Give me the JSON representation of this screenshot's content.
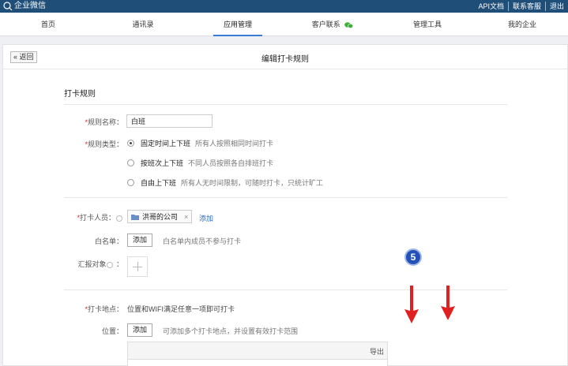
{
  "topbar": {
    "app_name": "企业微信",
    "links": [
      "API文档",
      "联系客服",
      "退出"
    ]
  },
  "nav": {
    "items": [
      {
        "label": "首页"
      },
      {
        "label": "通讯录"
      },
      {
        "label": "应用管理",
        "active": true
      },
      {
        "label": "客户联系",
        "has_wechat_icon": true
      },
      {
        "label": "管理工具"
      },
      {
        "label": "我的企业"
      }
    ]
  },
  "panel": {
    "back_label": "« 返回",
    "title": "编辑打卡规则"
  },
  "form": {
    "section_title": "打卡规则",
    "rule_name": {
      "label": "规则名称：",
      "value": "白班"
    },
    "rule_type": {
      "label": "规则类型：",
      "options": [
        {
          "title": "固定时间上下班",
          "desc": "所有人按照相同时间打卡",
          "checked": true
        },
        {
          "title": "按班次上下班",
          "desc": "不同人员按照各自排班打卡",
          "checked": false
        },
        {
          "title": "自由上下班",
          "desc": "所有人无时间限制，可随时打卡，只统计旷工",
          "checked": false
        }
      ]
    },
    "checkin_people": {
      "label": "打卡人员：",
      "tag": "洪哥的公司",
      "tag_close": "×",
      "add_label": "添加"
    },
    "whitelist": {
      "label": "白名单：",
      "button": "添加",
      "hint": "白名单内成员不参与打卡"
    },
    "report_target": {
      "label": "汇报对象"
    },
    "checkin_location": {
      "label": "打卡地点：",
      "desc": "位置和WIFI满足任意一项即可打卡"
    },
    "location": {
      "label": "位置：",
      "button": "添加",
      "hint": "可添加多个打卡地点，并设置有效打卡范围"
    },
    "table": {
      "header_right": "导出"
    }
  },
  "annotation": {
    "step_number": "5",
    "color": "#e02020"
  }
}
